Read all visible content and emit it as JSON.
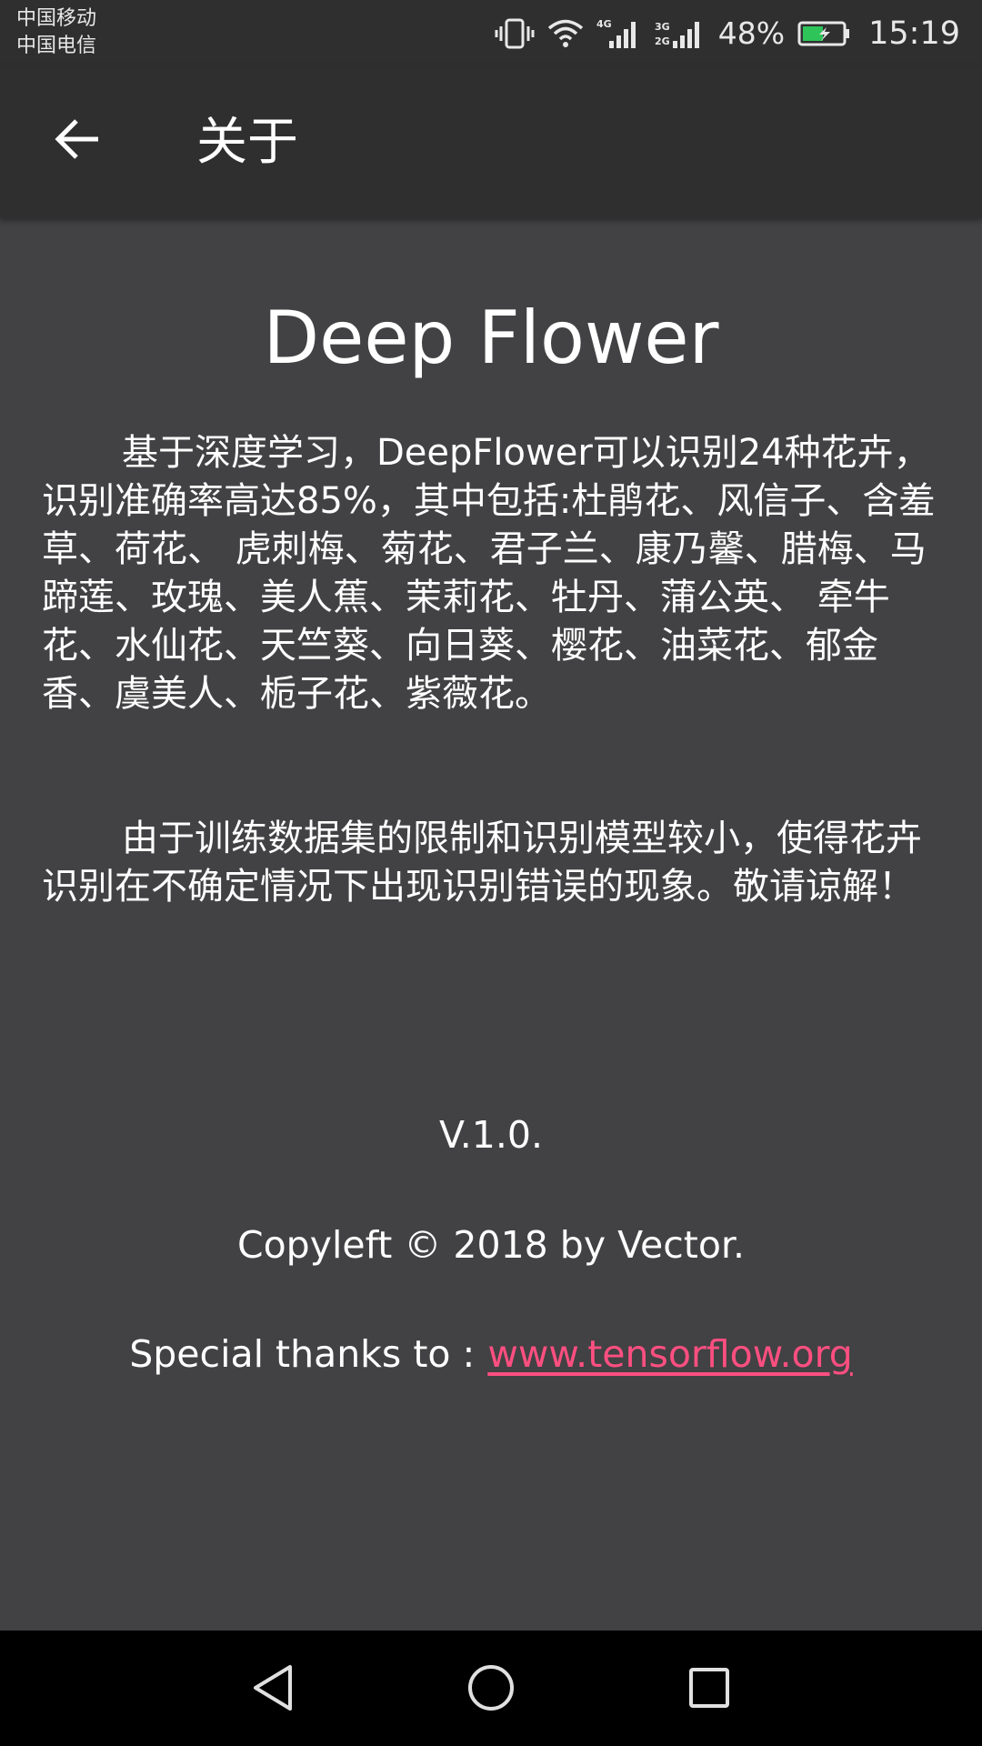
{
  "status_bar": {
    "carrier_1": "中国移动",
    "carrier_2": "中国电信",
    "icons": [
      "vibrate-icon",
      "wifi-icon",
      "signal-4g-icon",
      "signal-3g-2g-icon",
      "battery-charging-icon"
    ],
    "battery_percent": "48%",
    "time": "15:19"
  },
  "app_bar": {
    "back_icon": "arrow-back-icon",
    "title": "关于"
  },
  "content": {
    "app_name": "Deep Flower",
    "description": "基于深度学习，DeepFlower可以识别24种花卉，识别准确率高达85%，其中包括:杜鹃花、风信子、含羞草、荷花、 虎刺梅、菊花、君子兰、康乃馨、腊梅、马蹄莲、玫瑰、美人蕉、茉莉花、牡丹、蒲公英、 牵牛花、水仙花、天竺葵、向日葵、樱花、油菜花、郁金香、虞美人、栀子花、紫薇花。",
    "disclaimer": "由于训练数据集的限制和识别模型较小，使得花卉识别在不确定情况下出现识别错误的现象。敬请谅解！",
    "version": "V.1.0.",
    "copyleft": "Copyleft © 2018 by Vector.",
    "thanks_label": "Special thanks to :",
    "thanks_link": "www.tensorflow.org"
  },
  "nav_bar": {
    "buttons": [
      "nav-back-icon",
      "nav-home-icon",
      "nav-recents-icon"
    ]
  },
  "colors": {
    "background": "#424143",
    "app_bar": "#2f2f30",
    "link": "#ff4f81",
    "text": "#ffffff"
  }
}
